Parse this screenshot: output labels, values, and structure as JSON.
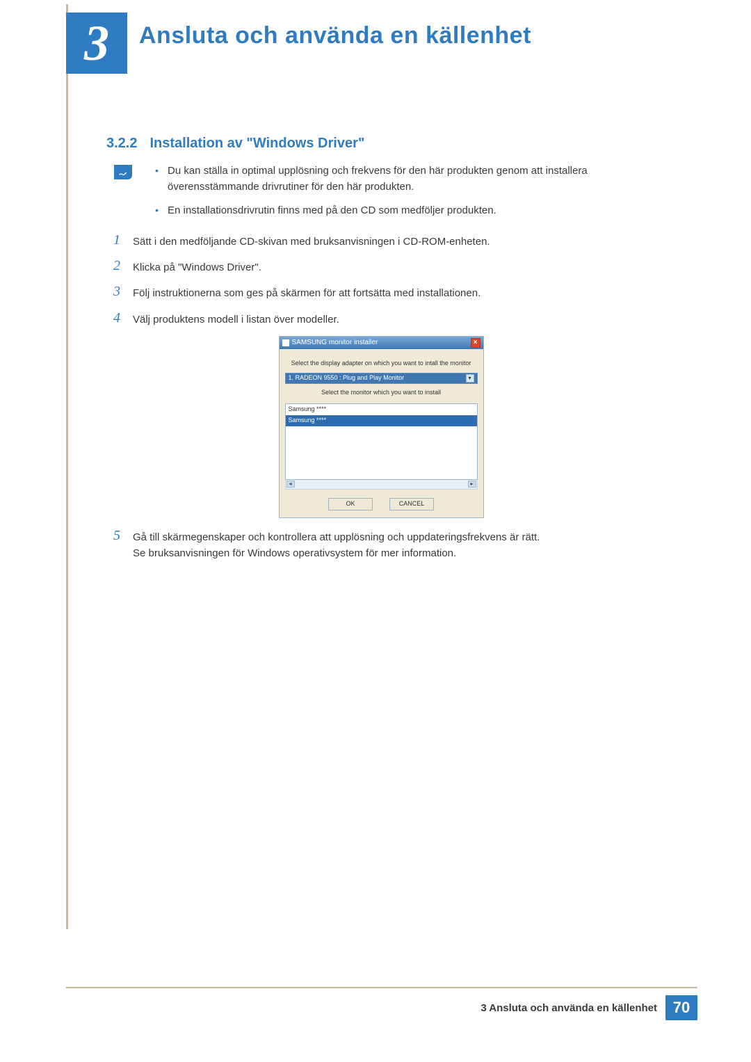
{
  "chapter": {
    "number": "3",
    "title": "Ansluta och använda en källenhet"
  },
  "section": {
    "number": "3.2.2",
    "title": "Installation av \"Windows Driver\""
  },
  "notes": [
    "Du kan ställa in optimal upplösning och frekvens för den här produkten genom att installera överensstämmande drivrutiner för den här produkten.",
    "En installationsdrivrutin finns med på den CD som medföljer produkten."
  ],
  "steps": {
    "s1": {
      "n": "1",
      "text": "Sätt i den medföljande CD-skivan med bruksanvisningen i CD-ROM-enheten."
    },
    "s2": {
      "n": "2",
      "text": "Klicka på \"Windows Driver\"."
    },
    "s3": {
      "n": "3",
      "text": "Följ instruktionerna som ges på skärmen för att fortsätta med installationen."
    },
    "s4": {
      "n": "4",
      "text": "Välj produktens modell i listan över modeller."
    },
    "s5": {
      "n": "5",
      "text": "Gå till skärmegenskaper och kontrollera att upplösning och uppdateringsfrekvens är rätt."
    },
    "s5b": "Se bruksanvisningen för Windows operativsystem för mer information."
  },
  "dialog": {
    "title": "SAMSUNG monitor installer",
    "label1": "Select the display adapter on which you want to intall the monitor",
    "adapter": "1. RADEON 9550 : Plug and Play Monitor",
    "label2": "Select the monitor which you want to install",
    "list": {
      "r0": "Samsung ****",
      "r1": "Samsung ****"
    },
    "ok": "OK",
    "cancel": "CANCEL"
  },
  "footer": {
    "text": "3 Ansluta och använda en källenhet",
    "page": "70"
  }
}
